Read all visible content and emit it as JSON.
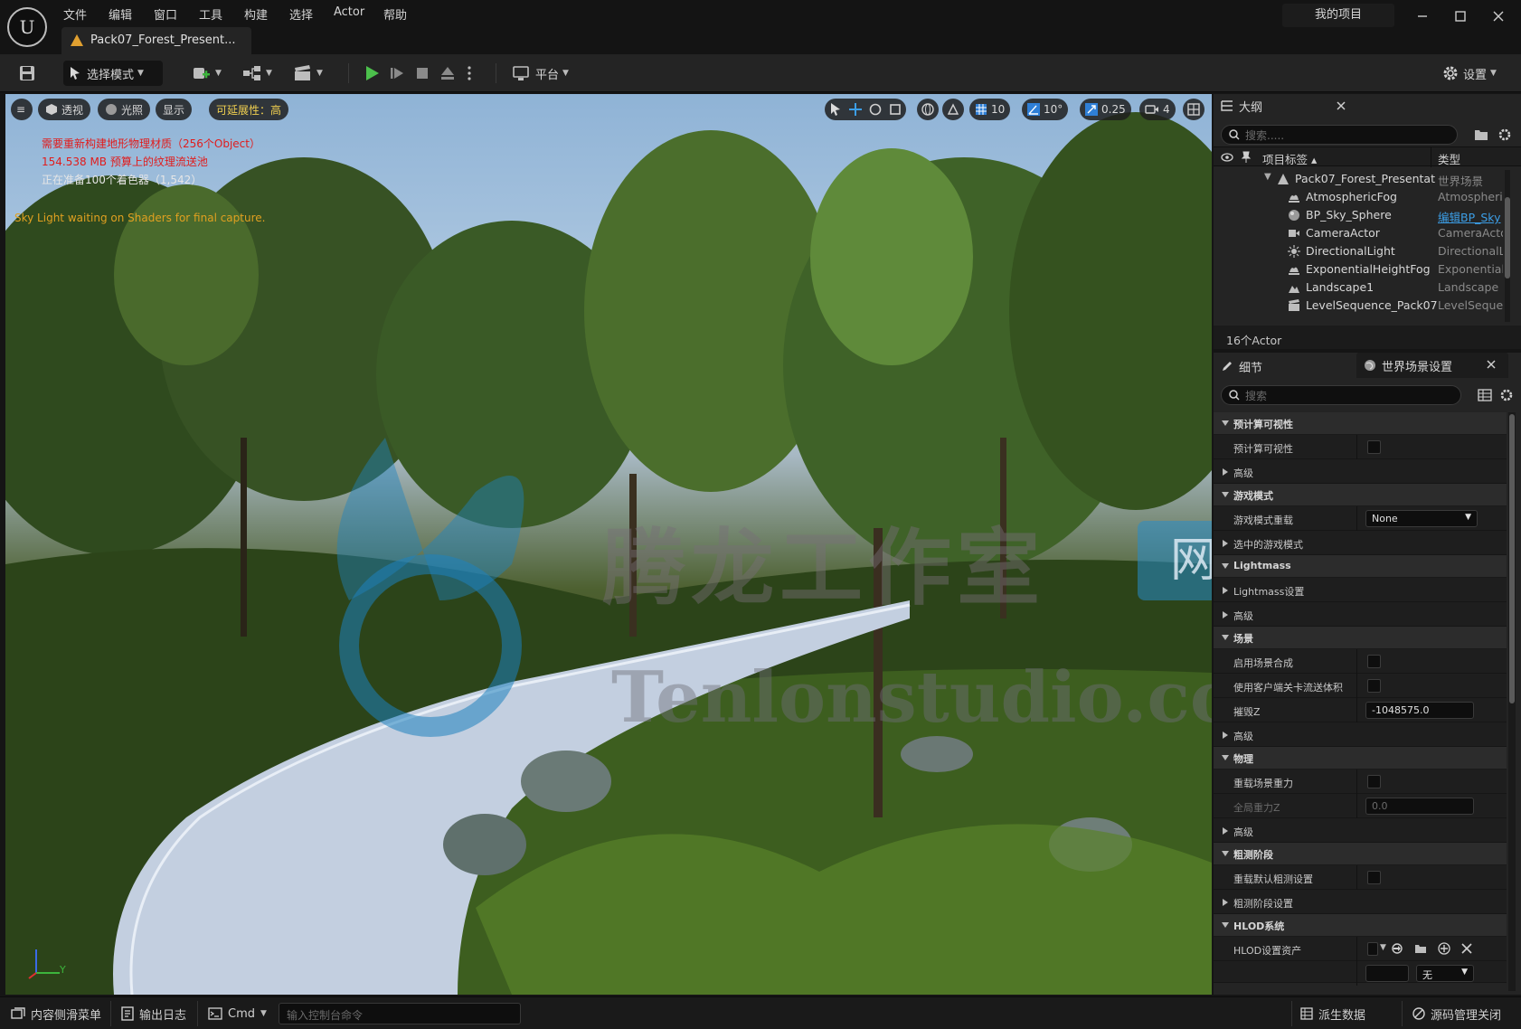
{
  "titlebar": {
    "logo_text": "U",
    "menus": [
      "文件",
      "编辑",
      "窗口",
      "工具",
      "构建",
      "选择",
      "Actor",
      "帮助"
    ],
    "document_tab": "Pack07_Forest_Present...",
    "project_name": "我的项目"
  },
  "toolbar": {
    "mode_label": "选择模式",
    "platform_label": "平台",
    "settings_label": "设置"
  },
  "viewport": {
    "menu_label": "≡",
    "perspective_label": "透视",
    "lighting_label": "光照",
    "show_label": "显示",
    "scalability_label": "可延展性：高",
    "grid_snap": "10",
    "rotation_snap": "10°",
    "scale_snap": "0.25",
    "camera_speed": "4",
    "messages": [
      {
        "text": "需要重新构建地形物理材质（256个Object）",
        "color": "#e11c1c"
      },
      {
        "text": "154.538 MB 预算上的纹理流送池",
        "color": "#e11c1c"
      },
      {
        "text": "正在准备100个着色器（1,542）",
        "color": "#e6e6e6"
      },
      {
        "text": "Sky Light waiting on Shaders for final capture.",
        "color": "#e0a020"
      }
    ],
    "watermark_cn": "腾龙工作室",
    "watermark_badge": "网站",
    "watermark_url": "Tenlonstudio.com",
    "axis_y": "Y"
  },
  "outliner": {
    "tab_label": "大纲",
    "search_placeholder": "搜索.....",
    "col_label": "项目标签 ▴",
    "col_type": "类型",
    "rows": [
      {
        "name": "Pack07_Forest_Presentat",
        "type": "世界场景"
      },
      {
        "name": "AtmosphericFog",
        "type": "Atmospheric"
      },
      {
        "name": "BP_Sky_Sphere",
        "type": "编辑BP_Sky"
      },
      {
        "name": "CameraActor",
        "type": "CameraActor"
      },
      {
        "name": "DirectionalLight",
        "type": "DirectionalL"
      },
      {
        "name": "ExponentialHeightFog",
        "type": "Exponentiall"
      },
      {
        "name": "Landscape1",
        "type": "Landscape"
      },
      {
        "name": "LevelSequence_Pack07",
        "type": "LevelSequen"
      }
    ],
    "count": "16个Actor"
  },
  "details": {
    "tab_details": "细节",
    "tab_world": "世界场景设置",
    "search_placeholder": "搜索",
    "items": [
      {
        "kind": "cat",
        "label": "预计算可视性"
      },
      {
        "kind": "check",
        "label": "预计算可视性"
      },
      {
        "kind": "sub",
        "label": "高级"
      },
      {
        "kind": "cat",
        "label": "游戏模式"
      },
      {
        "kind": "select",
        "label": "游戏模式重载",
        "value": "None"
      },
      {
        "kind": "sub",
        "label": "选中的游戏模式"
      },
      {
        "kind": "cat",
        "label": "Lightmass"
      },
      {
        "kind": "sub",
        "label": "Lightmass设置"
      },
      {
        "kind": "sub",
        "label": "高级"
      },
      {
        "kind": "cat",
        "label": "场景"
      },
      {
        "kind": "check",
        "label": "启用场景合成"
      },
      {
        "kind": "check",
        "label": "使用客户端关卡流送体积"
      },
      {
        "kind": "field",
        "label": "摧毁Z",
        "value": "-1048575.0"
      },
      {
        "kind": "sub",
        "label": "高级"
      },
      {
        "kind": "cat",
        "label": "物理"
      },
      {
        "kind": "check",
        "label": "重载场景重力"
      },
      {
        "kind": "disabled",
        "label": "全局重力Z",
        "value": "0.0"
      },
      {
        "kind": "sub",
        "label": "高级"
      },
      {
        "kind": "cat",
        "label": "粗测阶段"
      },
      {
        "kind": "check",
        "label": "重载默认粗测设置"
      },
      {
        "kind": "sub",
        "label": "粗测阶段设置"
      },
      {
        "kind": "cat",
        "label": "HLOD系统"
      },
      {
        "kind": "hlod",
        "label": "HLOD设置资产"
      },
      {
        "kind": "none",
        "label": "",
        "value": "无"
      }
    ]
  },
  "statusbar": {
    "content_drawer": "内容侧滑菜单",
    "output_log": "输出日志",
    "cmd": "Cmd",
    "console_placeholder": "输入控制台命令",
    "derived_data": "派生数据",
    "source_control": "源码管理关闭"
  }
}
